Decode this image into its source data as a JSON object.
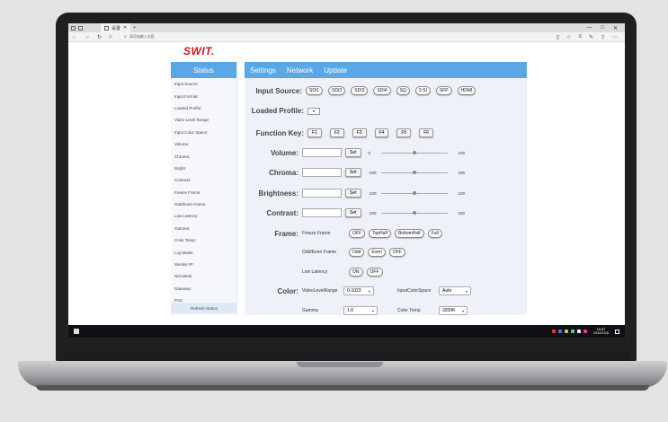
{
  "browser": {
    "tab_title": "设置",
    "new_tab": "+",
    "window_controls": [
      "—",
      "□",
      "✕"
    ],
    "url": "请添加输入内容",
    "nav": [
      "←",
      "→",
      "↻",
      "⌂"
    ],
    "tools": [
      "☆",
      "≡",
      "✎",
      "⇪",
      "⋯"
    ]
  },
  "logo": "SWIT.",
  "status": {
    "title": "Status",
    "items": [
      "Input Source:",
      "Input Format:",
      "Loaded Profile:",
      "Video Level Range:",
      "Input Color Space:",
      "Volume:",
      "Chroma:",
      "Bright:",
      "Contrast:",
      "Freeze Frame:",
      "Odd/Even Frame:",
      "Low Latency:",
      "Gamma:",
      "Color Temp:",
      "Log Mode:",
      "Monitor IP:",
      "Net Mask:",
      "Gateway:",
      "Port:"
    ],
    "refresh_label": "Refresh Status"
  },
  "tabs": [
    "Settings",
    "Network",
    "Update"
  ],
  "settings": {
    "input_source": {
      "label": "Input Source:",
      "options": [
        "SDI1",
        "SDI2",
        "SDI3",
        "SDI4",
        "SQ",
        "2-SI",
        "SFP",
        "HDMI"
      ]
    },
    "loaded_profile": {
      "label": "Loaded Profile:",
      "value": "▾"
    },
    "function_key": {
      "label": "Function Key:",
      "keys": [
        "F1",
        "F2",
        "F3",
        "F4",
        "F5",
        "F6"
      ]
    },
    "volume": {
      "label": "Volume:",
      "min": "0",
      "max": "100",
      "level": 0.5
    },
    "chroma": {
      "label": "Chroma:",
      "min": "-100",
      "max": "100",
      "level": 0.5
    },
    "brightness": {
      "label": "Brightness:",
      "min": "-100",
      "max": "100",
      "level": 0.5
    },
    "contrast": {
      "label": "Contrast:",
      "min": "-100",
      "max": "100",
      "level": 0.5
    },
    "set_label": "Set",
    "frame": {
      "label": "Frame:",
      "freeze_label": "Freeze Frame",
      "freeze_options": [
        "OFF",
        "TopHalf",
        "BottomHalf",
        "Full"
      ],
      "oddeven_label": "Odd/Even Frame",
      "oddeven_options": [
        "Odd",
        "Even",
        "OFF"
      ],
      "latency_label": "Low Latency",
      "latency_options": [
        "ON",
        "OFF"
      ]
    },
    "color": {
      "label": "Color:",
      "video_level_label": "VideoLevelRange",
      "video_level_value": "0-1023",
      "input_color_space_label": "InputColorSpace",
      "input_color_space_value": "Auto",
      "gamma_label": "Gamma",
      "gamma_value": "1.0",
      "color_temp_label": "Color Temp",
      "color_temp_value": "3200K"
    }
  },
  "taskbar": {
    "time": "16:57",
    "date": "2019/12/6",
    "tray_colors": [
      "#e03a3a",
      "#3a7be0",
      "#e0c03a",
      "#3ae07a",
      "#ffffff",
      "#e03ab0"
    ]
  }
}
